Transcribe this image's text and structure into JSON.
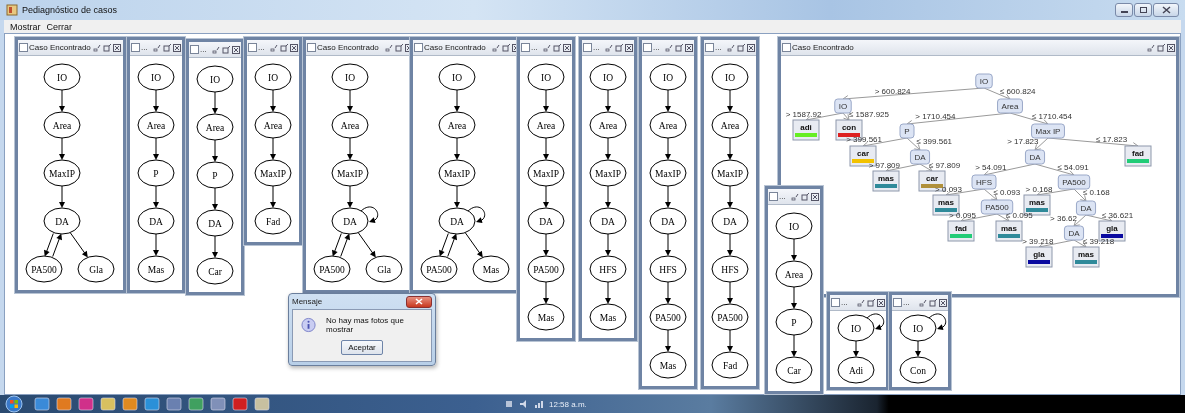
{
  "window": {
    "title": "Pediagnóstico de casos"
  },
  "menu": [
    "Mostrar",
    "Cerrar"
  ],
  "frames": [
    {
      "title": "Caso Encontrado",
      "kind": "graph",
      "graph": {
        "label": "IO",
        "loop": false,
        "children": [
          {
            "label": "Area",
            "loop": false,
            "back": false,
            "children": [
              {
                "label": "MaxIP",
                "loop": false,
                "back": false,
                "children": [
                  {
                    "label": "DA",
                    "loop": false,
                    "back": false,
                    "children": [
                      {
                        "label": "PA500",
                        "loop": false,
                        "back": true
                      },
                      {
                        "label": "Gla",
                        "loop": false,
                        "back": false
                      }
                    ]
                  }
                ]
              }
            ]
          }
        ]
      }
    },
    {
      "title": "...",
      "kind": "graph",
      "graph": {
        "label": "IO",
        "loop": false,
        "children": [
          {
            "label": "Area",
            "loop": false,
            "back": false,
            "children": [
              {
                "label": "P",
                "loop": false,
                "back": false,
                "children": [
                  {
                    "label": "DA",
                    "loop": false,
                    "back": false,
                    "children": [
                      {
                        "label": "Mas",
                        "loop": false,
                        "back": false
                      }
                    ]
                  }
                ]
              }
            ]
          }
        ]
      }
    },
    {
      "title": "...",
      "kind": "graph",
      "graph": {
        "label": "IO",
        "loop": false,
        "children": [
          {
            "label": "Area",
            "loop": false,
            "back": false,
            "children": [
              {
                "label": "P",
                "loop": false,
                "back": false,
                "children": [
                  {
                    "label": "DA",
                    "loop": false,
                    "back": false,
                    "children": [
                      {
                        "label": "Car",
                        "loop": false,
                        "back": false
                      }
                    ]
                  }
                ]
              }
            ]
          }
        ]
      }
    },
    {
      "title": "...",
      "kind": "graph",
      "graph": {
        "label": "IO",
        "loop": false,
        "children": [
          {
            "label": "Area",
            "loop": false,
            "back": false,
            "children": [
              {
                "label": "MaxIP",
                "loop": false,
                "back": false,
                "children": [
                  {
                    "label": "Fad",
                    "loop": false,
                    "back": false
                  }
                ]
              }
            ]
          }
        ]
      }
    },
    {
      "title": "Caso Encontrado",
      "kind": "graph",
      "graph": {
        "label": "IO",
        "loop": false,
        "children": [
          {
            "label": "Area",
            "loop": false,
            "back": false,
            "children": [
              {
                "label": "MaxIP",
                "loop": false,
                "back": false,
                "children": [
                  {
                    "label": "DA",
                    "loop": true,
                    "back": false,
                    "children": [
                      {
                        "label": "PA500",
                        "loop": false,
                        "back": true
                      },
                      {
                        "label": "Gla",
                        "loop": false,
                        "back": false
                      }
                    ]
                  }
                ]
              }
            ]
          }
        ]
      }
    },
    {
      "title": "Caso Encontrado",
      "kind": "graph",
      "graph": {
        "label": "IO",
        "loop": false,
        "children": [
          {
            "label": "Area",
            "loop": false,
            "back": false,
            "children": [
              {
                "label": "MaxIP",
                "loop": false,
                "back": false,
                "children": [
                  {
                    "label": "DA",
                    "loop": true,
                    "back": false,
                    "children": [
                      {
                        "label": "PA500",
                        "loop": false,
                        "back": true
                      },
                      {
                        "label": "Mas",
                        "loop": false,
                        "back": false
                      }
                    ]
                  }
                ]
              }
            ]
          }
        ]
      }
    },
    {
      "title": "...",
      "kind": "graph",
      "graph": {
        "label": "IO",
        "loop": false,
        "children": [
          {
            "label": "Area",
            "loop": false,
            "back": false,
            "children": [
              {
                "label": "MaxIP",
                "loop": false,
                "back": false,
                "children": [
                  {
                    "label": "DA",
                    "loop": false,
                    "back": false,
                    "children": [
                      {
                        "label": "PA500",
                        "loop": false,
                        "back": false,
                        "children": [
                          {
                            "label": "Mas",
                            "loop": false,
                            "back": false
                          }
                        ]
                      }
                    ]
                  }
                ]
              }
            ]
          }
        ]
      }
    },
    {
      "title": "...",
      "kind": "graph",
      "graph": {
        "label": "IO",
        "loop": false,
        "children": [
          {
            "label": "Area",
            "loop": false,
            "back": false,
            "children": [
              {
                "label": "MaxIP",
                "loop": false,
                "back": false,
                "children": [
                  {
                    "label": "DA",
                    "loop": false,
                    "back": false,
                    "children": [
                      {
                        "label": "HFS",
                        "loop": false,
                        "back": false,
                        "children": [
                          {
                            "label": "Mas",
                            "loop": false,
                            "back": false
                          }
                        ]
                      }
                    ]
                  }
                ]
              }
            ]
          }
        ]
      }
    },
    {
      "title": "...",
      "kind": "graph",
      "graph": {
        "label": "IO",
        "loop": false,
        "children": [
          {
            "label": "Area",
            "loop": false,
            "back": false,
            "children": [
              {
                "label": "MaxIP",
                "loop": false,
                "back": false,
                "children": [
                  {
                    "label": "DA",
                    "loop": false,
                    "back": false,
                    "children": [
                      {
                        "label": "HFS",
                        "loop": false,
                        "back": false,
                        "children": [
                          {
                            "label": "PA500",
                            "loop": false,
                            "back": false,
                            "children": [
                              {
                                "label": "Mas",
                                "loop": false,
                                "back": false
                              }
                            ]
                          }
                        ]
                      }
                    ]
                  }
                ]
              }
            ]
          }
        ]
      }
    },
    {
      "title": "...",
      "kind": "graph",
      "graph": {
        "label": "IO",
        "loop": false,
        "children": [
          {
            "label": "Area",
            "loop": false,
            "back": false,
            "children": [
              {
                "label": "MaxIP",
                "loop": false,
                "back": false,
                "children": [
                  {
                    "label": "DA",
                    "loop": false,
                    "back": false,
                    "children": [
                      {
                        "label": "HFS",
                        "loop": false,
                        "back": false,
                        "children": [
                          {
                            "label": "PA500",
                            "loop": false,
                            "back": false,
                            "children": [
                              {
                                "label": "Fad",
                                "loop": false,
                                "back": false
                              }
                            ]
                          }
                        ]
                      }
                    ]
                  }
                ]
              }
            ]
          }
        ]
      }
    },
    {
      "title": "Caso Encontrado",
      "kind": "tree",
      "tree": {
        "kind": "split",
        "label": "IO",
        "children": [
          {
            "kind": "split",
            "edge": "> 600.824",
            "label": "IO",
            "children": [
              {
                "kind": "leaf",
                "edge": "> 1587.92",
                "label": "adi",
                "color": "#66ee22"
              },
              {
                "kind": "leaf",
                "edge": "≤ 1587.925",
                "label": "con",
                "color": "#dd2020"
              }
            ]
          },
          {
            "kind": "split",
            "edge": "≤ 600.824",
            "label": "Area",
            "children": [
              {
                "kind": "split",
                "edge": "> 1710.454",
                "label": "P",
                "children": [
                  {
                    "kind": "leaf",
                    "edge": "> 399.561",
                    "label": "car",
                    "color": "#f2c200"
                  },
                  {
                    "kind": "split",
                    "edge": "≤ 399.561",
                    "label": "DA",
                    "children": [
                      {
                        "kind": "leaf",
                        "edge": "> 97.809",
                        "label": "mas",
                        "color": "#2f8a9a"
                      },
                      {
                        "kind": "leaf",
                        "edge": "≤ 97.809",
                        "label": "car",
                        "color": "#b0903a"
                      }
                    ]
                  }
                ]
              },
              {
                "kind": "split",
                "edge": "≤ 1710.454",
                "label": "Max IP",
                "children": [
                  {
                    "kind": "split",
                    "edge": "> 17.823",
                    "label": "DA",
                    "children": [
                      {
                        "kind": "split",
                        "edge": "> 54.091",
                        "label": "HFS",
                        "children": [
                          {
                            "kind": "leaf",
                            "edge": "> 0.093",
                            "label": "mas",
                            "color": "#2f8a9a"
                          },
                          {
                            "kind": "split",
                            "edge": "≤ 0.093",
                            "label": "PA500",
                            "children": [
                              {
                                "kind": "leaf",
                                "edge": "> 0.095",
                                "label": "fad",
                                "color": "#22cc77"
                              },
                              {
                                "kind": "leaf",
                                "edge": "≤ 0.095",
                                "label": "mas",
                                "color": "#2f8a9a"
                              }
                            ]
                          }
                        ]
                      },
                      {
                        "kind": "split",
                        "edge": "≤ 54.091",
                        "label": "PA500",
                        "children": [
                          {
                            "kind": "leaf",
                            "edge": "> 0.168",
                            "label": "mas",
                            "color": "#2f8a9a"
                          },
                          {
                            "kind": "split",
                            "edge": "≤ 0.168",
                            "label": "DA",
                            "children": [
                              {
                                "kind": "split",
                                "edge": "> 36.62",
                                "label": "DA",
                                "children": [
                                  {
                                    "kind": "leaf",
                                    "edge": "> 39.218",
                                    "label": "gla",
                                    "color": "#0a0aa0"
                                  },
                                  {
                                    "kind": "leaf",
                                    "edge": "≤ 39.218",
                                    "label": "mas",
                                    "color": "#2f8a9a"
                                  }
                                ]
                              },
                              {
                                "kind": "leaf",
                                "edge": "≤ 36.621",
                                "label": "gla",
                                "color": "#0a0aa0"
                              }
                            ]
                          }
                        ]
                      }
                    ]
                  },
                  {
                    "kind": "leaf",
                    "edge": "≤ 17.823",
                    "label": "fad",
                    "color": "#22cc77"
                  }
                ]
              }
            ]
          }
        ]
      }
    },
    {
      "title": "...",
      "kind": "graph",
      "graph": {
        "label": "IO",
        "loop": false,
        "children": [
          {
            "label": "Area",
            "loop": false,
            "back": false,
            "children": [
              {
                "label": "P",
                "loop": false,
                "back": false,
                "children": [
                  {
                    "label": "Car",
                    "loop": false,
                    "back": false
                  }
                ]
              }
            ]
          }
        ]
      }
    },
    {
      "title": "...",
      "kind": "graph",
      "graph": {
        "label": "IO",
        "loop": true,
        "children": [
          {
            "label": "Adi",
            "loop": false,
            "back": false
          }
        ]
      }
    },
    {
      "title": "...",
      "kind": "graph",
      "graph": {
        "label": "IO",
        "loop": true,
        "children": [
          {
            "label": "Con",
            "loop": false,
            "back": false
          }
        ]
      }
    }
  ],
  "dialog": {
    "title": "Mensaje",
    "message": "No hay mas fotos que mostrar",
    "button": "Aceptar"
  },
  "taskbar": {
    "clock": "12:58 a.m."
  }
}
